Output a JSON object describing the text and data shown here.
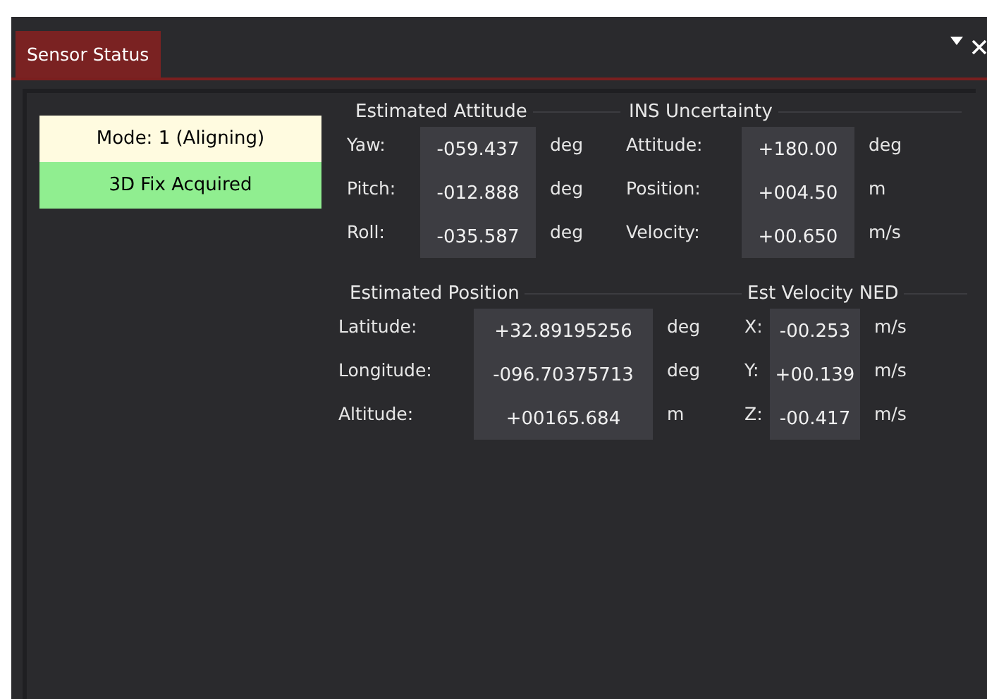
{
  "tab": {
    "title": "Sensor Status",
    "selected": true
  },
  "status": [
    {
      "text": "Mode: 1 (Aligning)",
      "color": "#fffbe0"
    },
    {
      "text": "3D Fix Acquired",
      "color": "#90ee90"
    }
  ],
  "groups": [
    {
      "title": "Estimated Attitude",
      "rows": [
        {
          "label": "Yaw:",
          "value": "-059.437",
          "unit": "deg"
        },
        {
          "label": "Pitch:",
          "value": "-012.888",
          "unit": "deg"
        },
        {
          "label": "Roll:",
          "value": "-035.587",
          "unit": "deg"
        }
      ]
    },
    {
      "title": "INS Uncertainty",
      "rows": [
        {
          "label": "Attitude:",
          "value": "+180.00",
          "unit": "deg"
        },
        {
          "label": "Position:",
          "value": "+004.50",
          "unit": "m"
        },
        {
          "label": "Velocity:",
          "value": "+00.650",
          "unit": "m/s"
        }
      ]
    },
    {
      "title": "Estimated Position",
      "rows": [
        {
          "label": "Latitude:",
          "value": "+32.89195256",
          "unit": "deg"
        },
        {
          "label": "Longitude:",
          "value": "-096.70375713",
          "unit": "deg"
        },
        {
          "label": "Altitude:",
          "value": "+00165.684",
          "unit": "m"
        }
      ]
    },
    {
      "title": "Est Velocity NED",
      "rows": [
        {
          "label": "X:",
          "value": "-00.253",
          "unit": "m/s"
        },
        {
          "label": "Y:",
          "value": "+00.139",
          "unit": "m/s"
        },
        {
          "label": "Z:",
          "value": "-00.417",
          "unit": "m/s"
        }
      ]
    }
  ]
}
